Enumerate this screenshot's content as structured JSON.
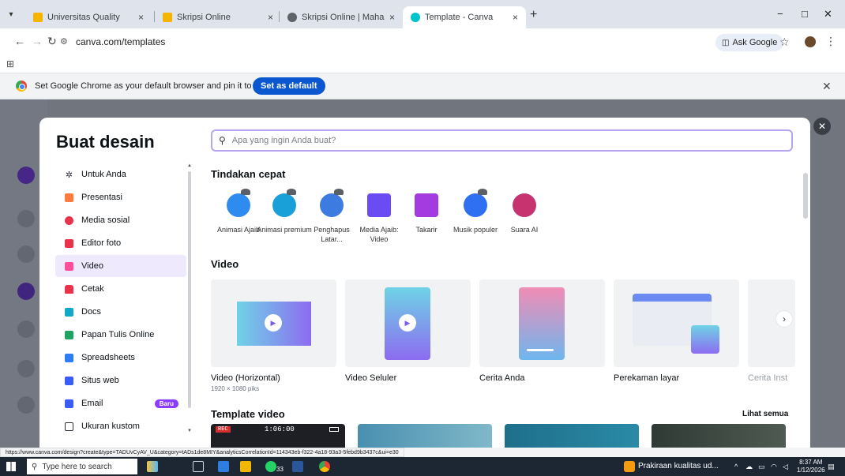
{
  "browser": {
    "tabs": [
      {
        "title": "Universitas Quality"
      },
      {
        "title": "Skripsi Online"
      },
      {
        "title": "Skripsi Online | Mahasiswa"
      },
      {
        "title": "Template - Canva"
      }
    ],
    "new_tab": "+",
    "url": "canva.com/templates",
    "ask_google": "Ask Google",
    "infobar": {
      "message": "Set Google Chrome as your default browser and pin it to your taskbar",
      "button": "Set as default"
    },
    "status_url": "https://www.canva.com/design?create&type=TADUvCyAV_U&category=tADs1de8MIY&analyticsCorrelationId=114343eb-f322-4a18-93a3-5febd9b3437c&ui=e30"
  },
  "modal": {
    "title": "Buat desain",
    "search_placeholder": "Apa yang ingin Anda buat?",
    "sidebar": [
      {
        "label": "Untuk Anda",
        "color": "#2b2f36"
      },
      {
        "label": "Presentasi",
        "color": "#ff7a3d"
      },
      {
        "label": "Media sosial",
        "color": "#e8334a"
      },
      {
        "label": "Editor foto",
        "color": "#e8334a"
      },
      {
        "label": "Video",
        "color": "#ff4f9a"
      },
      {
        "label": "Cetak",
        "color": "#e8334a"
      },
      {
        "label": "Docs",
        "color": "#12a8c9"
      },
      {
        "label": "Papan Tulis Online",
        "color": "#1fa463"
      },
      {
        "label": "Spreadsheets",
        "color": "#2e7cf6"
      },
      {
        "label": "Situs web",
        "color": "#3a5cf6"
      },
      {
        "label": "Email",
        "color": "#3a5cf6",
        "badge": "Baru"
      },
      {
        "label": "Ukuran kustom",
        "color": "#2b2f36"
      }
    ],
    "quick_actions_title": "Tindakan cepat",
    "quick_actions": [
      {
        "label": "Animasi Ajaib",
        "color": "#2e8cf0"
      },
      {
        "label": "Animasi premium",
        "color": "#1aa0d8"
      },
      {
        "label": "Penghapus Latar...",
        "color": "#3d7be0"
      },
      {
        "label": "Media Ajaib: Video",
        "color": "#6a4cf2"
      },
      {
        "label": "Takarir",
        "color": "#a33be0"
      },
      {
        "label": "Musik populer",
        "color": "#2f6ff2"
      },
      {
        "label": "Suara AI",
        "color": "#c6336f"
      }
    ],
    "video_title": "Video",
    "video_cards": [
      {
        "label": "Video (Horizontal)",
        "sub": "1920 × 1080 piks"
      },
      {
        "label": "Video Seluler"
      },
      {
        "label": "Cerita Anda"
      },
      {
        "label": "Perekaman layar"
      },
      {
        "label": "Cerita Inst"
      }
    ],
    "template_video_title": "Template video",
    "see_all": "Lihat semua",
    "rec_label": "REC",
    "rec_time": "1:06:00"
  },
  "taskbar": {
    "search_placeholder": "Type here to search",
    "weather": "Prakiraan kualitas ud...",
    "time": "8:37 AM",
    "date": "1/12/2026",
    "notification_count": "33"
  }
}
